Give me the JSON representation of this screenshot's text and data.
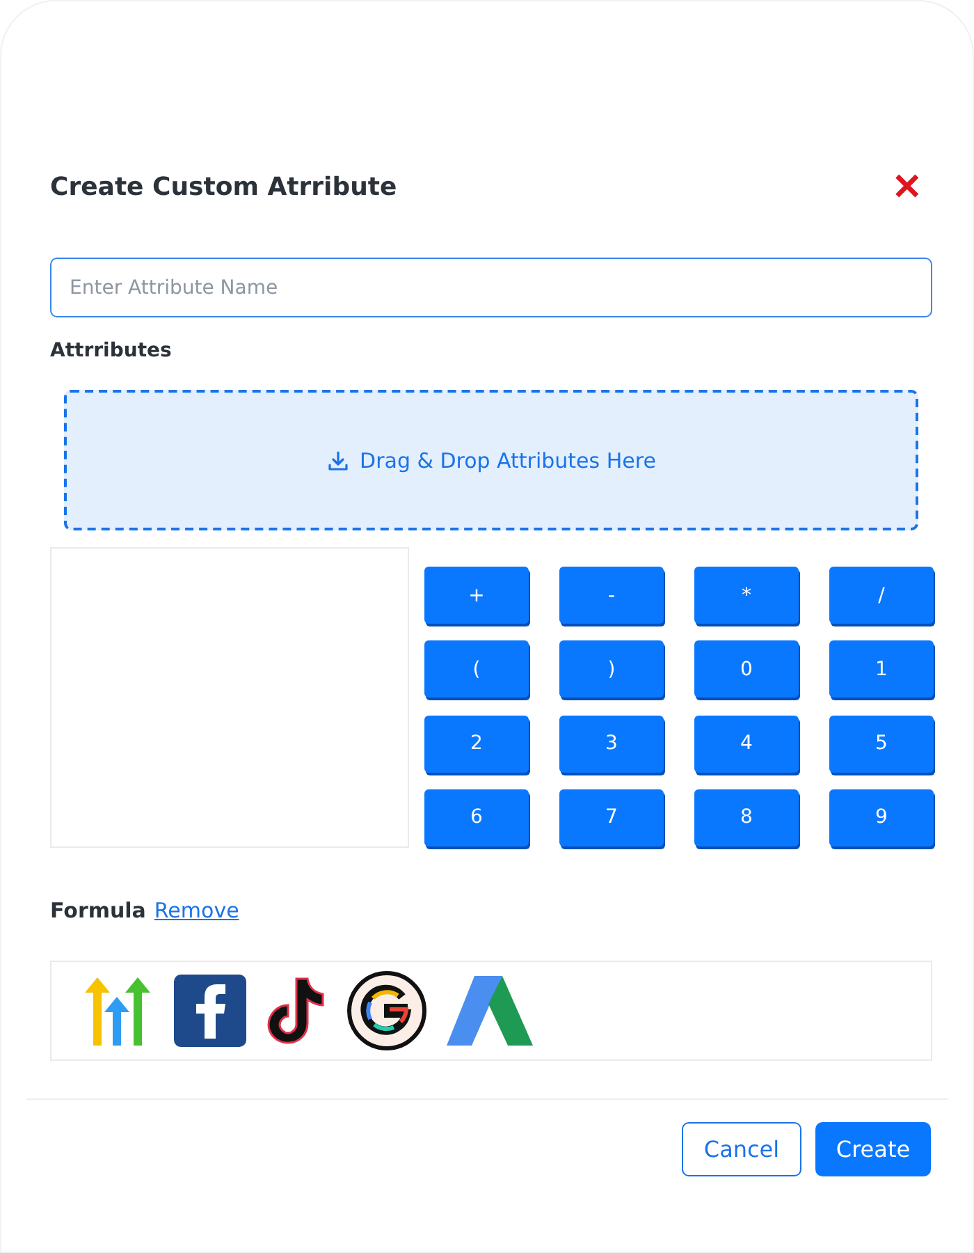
{
  "dialog": {
    "title": "Create Custom Atrribute",
    "close": "✕"
  },
  "name_field": {
    "placeholder": "Enter Attribute Name"
  },
  "attributes_label": "Attrributes",
  "dropzone": {
    "text": "Drag & Drop Attributes Here"
  },
  "keypad": [
    "+",
    "-",
    "*",
    "/",
    "(",
    ")",
    "0",
    "1",
    "2",
    "3",
    "4",
    "5",
    "6",
    "7",
    "8",
    "9"
  ],
  "formula": {
    "label": "Formula",
    "remove_link": "Remove"
  },
  "sources": [
    {
      "kind": "arrows"
    },
    {
      "kind": "square-f"
    },
    {
      "kind": "note"
    },
    {
      "kind": "g-ring"
    },
    {
      "kind": "a-shape"
    }
  ],
  "buttons": {
    "cancel": "Cancel",
    "create": "Create"
  }
}
